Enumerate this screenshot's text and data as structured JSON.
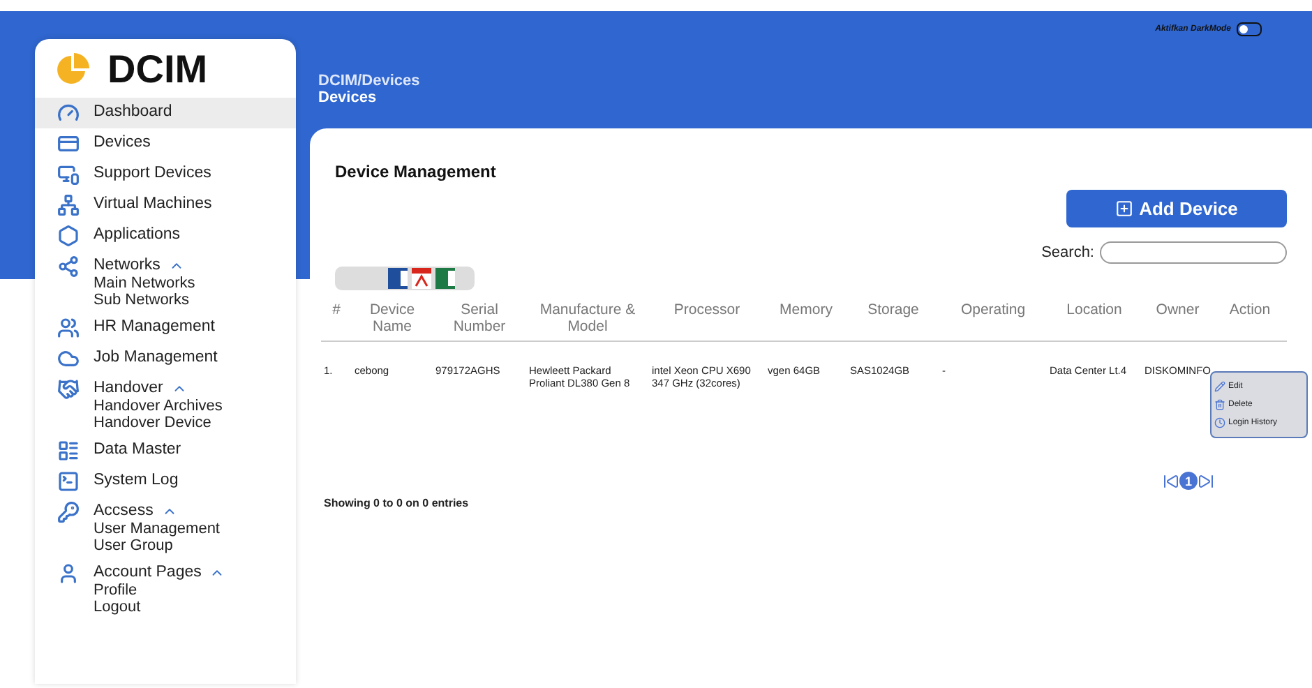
{
  "brand": {
    "title": "DCIM"
  },
  "sidebar": {
    "items": [
      {
        "label": "Dashboard",
        "selected": true
      },
      {
        "label": "Devices",
        "selected": false
      },
      {
        "label": "Support Devices",
        "selected": false
      },
      {
        "label": "Virtual Machines",
        "selected": false
      },
      {
        "label": "Applications",
        "selected": false
      },
      {
        "label": "Networks",
        "selected": false,
        "expanded": true,
        "children": [
          {
            "label": "Main Networks"
          },
          {
            "label": "Sub Networks"
          }
        ]
      },
      {
        "label": "HR Management",
        "selected": false
      },
      {
        "label": "Job Management",
        "selected": false
      },
      {
        "label": "Handover",
        "selected": false,
        "expanded": true,
        "children": [
          {
            "label": "Handover Archives"
          },
          {
            "label": "Handover Device"
          }
        ]
      },
      {
        "label": "Data Master",
        "selected": false
      },
      {
        "label": "System Log",
        "selected": false
      },
      {
        "label": "Accsess",
        "selected": false,
        "expanded": true,
        "children": [
          {
            "label": "User Management"
          },
          {
            "label": "User Group"
          }
        ]
      },
      {
        "label": "Account Pages",
        "selected": false,
        "expanded": true,
        "children": [
          {
            "label": "Profile"
          },
          {
            "label": "Logout"
          }
        ]
      }
    ]
  },
  "header": {
    "breadcrumb": "DCIM/Devices",
    "page_title": "Devices",
    "dark_mode": {
      "label": "Aktifkan DarkMode",
      "on": false
    }
  },
  "panel": {
    "title": "Device Management",
    "add_button": "Add Device",
    "search": {
      "label": "Search:"
    },
    "table": {
      "columns": [
        "#",
        "Device Name",
        "Serial Number",
        "Manufacture & Model",
        "Processor",
        "Memory",
        "Storage",
        "Operating",
        "Location",
        "Owner",
        "Action"
      ],
      "rows": [
        {
          "cells": [
            "1.",
            "cebong",
            "979172AGHS",
            "Hewleett Packard Proliant DL380 Gen 8",
            "intel Xeon CPU X690  347 GHz (32cores)",
            "vgen 64GB",
            "SAS1024GB",
            "-",
            "Data Center Lt.4",
            "DISKOMINFO"
          ]
        }
      ]
    },
    "action_menu": [
      {
        "label": "Edit"
      },
      {
        "label": "Delete"
      },
      {
        "label": "Login History"
      }
    ],
    "footer": "Showing 0 to 0 on 0 entries",
    "pagination": {
      "pages": [
        {
          "label": "1",
          "selected": true
        }
      ]
    }
  }
}
